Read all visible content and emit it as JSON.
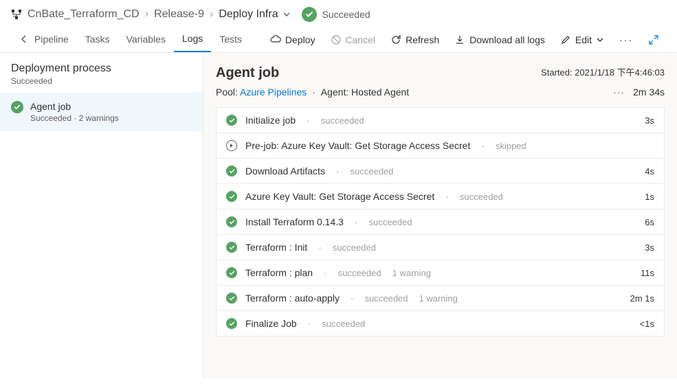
{
  "breadcrumb": {
    "items": [
      "CnBate_Terraform_CD",
      "Release-9",
      "Deploy Infra"
    ]
  },
  "header_status": {
    "label": "Succeeded"
  },
  "tabs": {
    "pipeline": "Pipeline",
    "tasks": "Tasks",
    "variables": "Variables",
    "logs": "Logs",
    "tests": "Tests"
  },
  "toolbar": {
    "deploy": "Deploy",
    "cancel": "Cancel",
    "refresh": "Refresh",
    "download": "Download all logs",
    "edit": "Edit"
  },
  "sidebar": {
    "title": "Deployment process",
    "subtitle": "Succeeded",
    "item": {
      "label": "Agent job",
      "meta": "Succeeded · 2 warnings"
    }
  },
  "main": {
    "title": "Agent job",
    "started_prefix": "Started: ",
    "started_value": "2021/1/18 下午4:46:03",
    "pool_label": "Pool: ",
    "pool_link": "Azure Pipelines",
    "agent_label": "Agent: Hosted Agent",
    "duration": "2m 34s"
  },
  "tasks": [
    {
      "name": "Initialize job",
      "status": "succeeded",
      "warn": "",
      "dur": "3s",
      "icon": "success"
    },
    {
      "name": "Pre-job: Azure Key Vault: Get Storage Access Secret",
      "status": "skipped",
      "warn": "",
      "dur": "",
      "icon": "skipped"
    },
    {
      "name": "Download Artifacts",
      "status": "succeeded",
      "warn": "",
      "dur": "4s",
      "icon": "success"
    },
    {
      "name": "Azure Key Vault: Get Storage Access Secret",
      "status": "succeeded",
      "warn": "",
      "dur": "1s",
      "icon": "success"
    },
    {
      "name": "Install Terraform 0.14.3",
      "status": "succeeded",
      "warn": "",
      "dur": "6s",
      "icon": "success"
    },
    {
      "name": "Terraform : Init",
      "status": "succeeded",
      "warn": "",
      "dur": "3s",
      "icon": "success"
    },
    {
      "name": "Terraform : plan",
      "status": "succeeded",
      "warn": "1 warning",
      "dur": "11s",
      "icon": "success"
    },
    {
      "name": "Terraform : auto-apply",
      "status": "succeeded",
      "warn": "1 warning",
      "dur": "2m 1s",
      "icon": "success"
    },
    {
      "name": "Finalize Job",
      "status": "succeeded",
      "warn": "",
      "dur": "<1s",
      "icon": "success"
    }
  ]
}
